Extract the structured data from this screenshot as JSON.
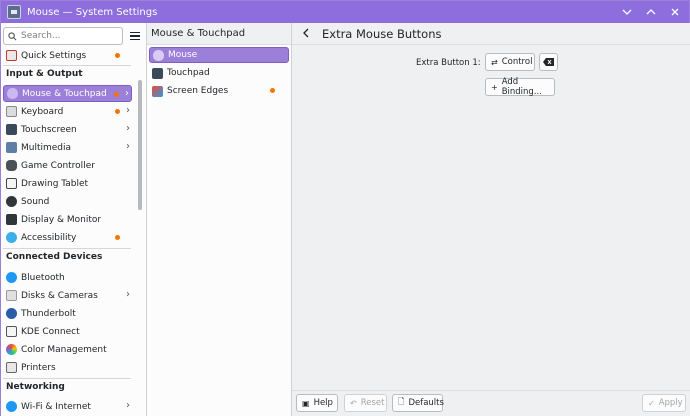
{
  "window": {
    "title": "Mouse — System Settings"
  },
  "titlebar": {
    "min_icon": "chevron-down-icon",
    "max_icon": "chevron-up-icon",
    "close_icon": "close-icon"
  },
  "sidebar": {
    "search_placeholder": "Search...",
    "top_item": {
      "label": "Quick Settings",
      "icon": "quick-settings-icon"
    },
    "sections": [
      {
        "header": "Input & Output",
        "items": [
          {
            "label": "Mouse & Touchpad",
            "icon": "mouse-icon",
            "active": true
          },
          {
            "label": "Keyboard",
            "icon": "keyboard-icon"
          },
          {
            "label": "Touchscreen",
            "icon": "touchscreen-icon"
          },
          {
            "label": "Multimedia",
            "icon": "multimedia-icon"
          },
          {
            "label": "Game Controller",
            "icon": "gamepad-icon"
          },
          {
            "label": "Drawing Tablet",
            "icon": "tablet-icon"
          },
          {
            "label": "Sound",
            "icon": "speaker-icon"
          },
          {
            "label": "Display & Monitor",
            "icon": "monitor-icon"
          },
          {
            "label": "Accessibility",
            "icon": "accessibility-icon"
          }
        ]
      },
      {
        "header": "Connected Devices",
        "items": [
          {
            "label": "Bluetooth",
            "icon": "bluetooth-icon"
          },
          {
            "label": "Disks & Cameras",
            "icon": "disk-icon"
          },
          {
            "label": "Thunderbolt",
            "icon": "thunderbolt-icon"
          },
          {
            "label": "KDE Connect",
            "icon": "kde-connect-icon"
          },
          {
            "label": "Color Management",
            "icon": "color-icon"
          },
          {
            "label": "Printers",
            "icon": "printer-icon"
          }
        ]
      },
      {
        "header": "Networking",
        "items": [
          {
            "label": "Wi-Fi & Internet",
            "icon": "wifi-icon"
          }
        ]
      }
    ]
  },
  "midpane": {
    "title": "Mouse & Touchpad",
    "items": [
      {
        "label": "Mouse",
        "icon": "mouse-icon",
        "active": true
      },
      {
        "label": "Touchpad",
        "icon": "touchpad-icon"
      },
      {
        "label": "Screen Edges",
        "icon": "screen-edges-icon"
      }
    ]
  },
  "main": {
    "title": "Extra Mouse Buttons",
    "binding_label": "Extra Button 1:",
    "binding_value": "Control",
    "add_binding": "Add Binding...",
    "footer": {
      "help": "Help",
      "reset": "Reset",
      "defaults": "Defaults",
      "apply": "Apply"
    }
  },
  "colors": {
    "accent": "#9b7fd8",
    "titlebar": "#8e6ddc",
    "attention": "#f67400"
  }
}
